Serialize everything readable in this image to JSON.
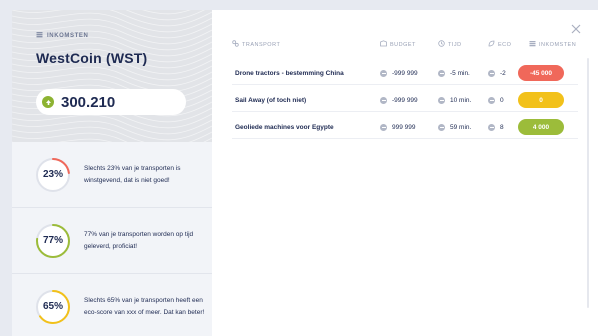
{
  "hero": {
    "label": "INKOMSTEN",
    "title": "WestCoin (WST)",
    "balance": "300.210",
    "accent": "#8db332"
  },
  "stats": [
    {
      "percent_label": "23%",
      "progress": 0.23,
      "color": "#f0685a",
      "text": "Slechts 23% van je transporten is winstgevend, dat is niet goed!"
    },
    {
      "percent_label": "77%",
      "progress": 0.77,
      "color": "#9cbc3a",
      "text": "77% van je transporten worden op tijd geleverd, proficiat!"
    },
    {
      "percent_label": "65%",
      "progress": 0.65,
      "color": "#f2c11a",
      "text": "Slechts 65% van je transporten heeft een eco-score van xxx of meer. Dat kan beter!"
    }
  ],
  "table": {
    "headers": {
      "transport": "TRANSPORT",
      "budget": "BUDGET",
      "tijd": "TIJD",
      "eco": "ECO",
      "inkomsten": "INKOMSTEN"
    },
    "rows": [
      {
        "name": "Drone tractors - bestemming China",
        "budget": "-999 999",
        "tijd": "-5 min.",
        "eco": "-2",
        "inkomsten": "-45 000",
        "pill_color": "#f0685a"
      },
      {
        "name": "Sail Away (of toch niet)",
        "budget": "-999 999",
        "tijd": "10 min.",
        "eco": "0",
        "inkomsten": "0",
        "pill_color": "#f2c11a"
      },
      {
        "name": "Geoliede machines voor Egypte",
        "budget": "999 999",
        "tijd": "59 min.",
        "eco": "8",
        "inkomsten": "4 000",
        "pill_color": "#9cbc3a"
      }
    ]
  },
  "icons": {
    "close": "close-icon",
    "label": "coin-stack-icon",
    "transport": "link-icon",
    "budget": "wallet-icon",
    "tijd": "clock-icon",
    "eco": "leaf-icon",
    "inkomsten": "coin-stack-icon"
  }
}
